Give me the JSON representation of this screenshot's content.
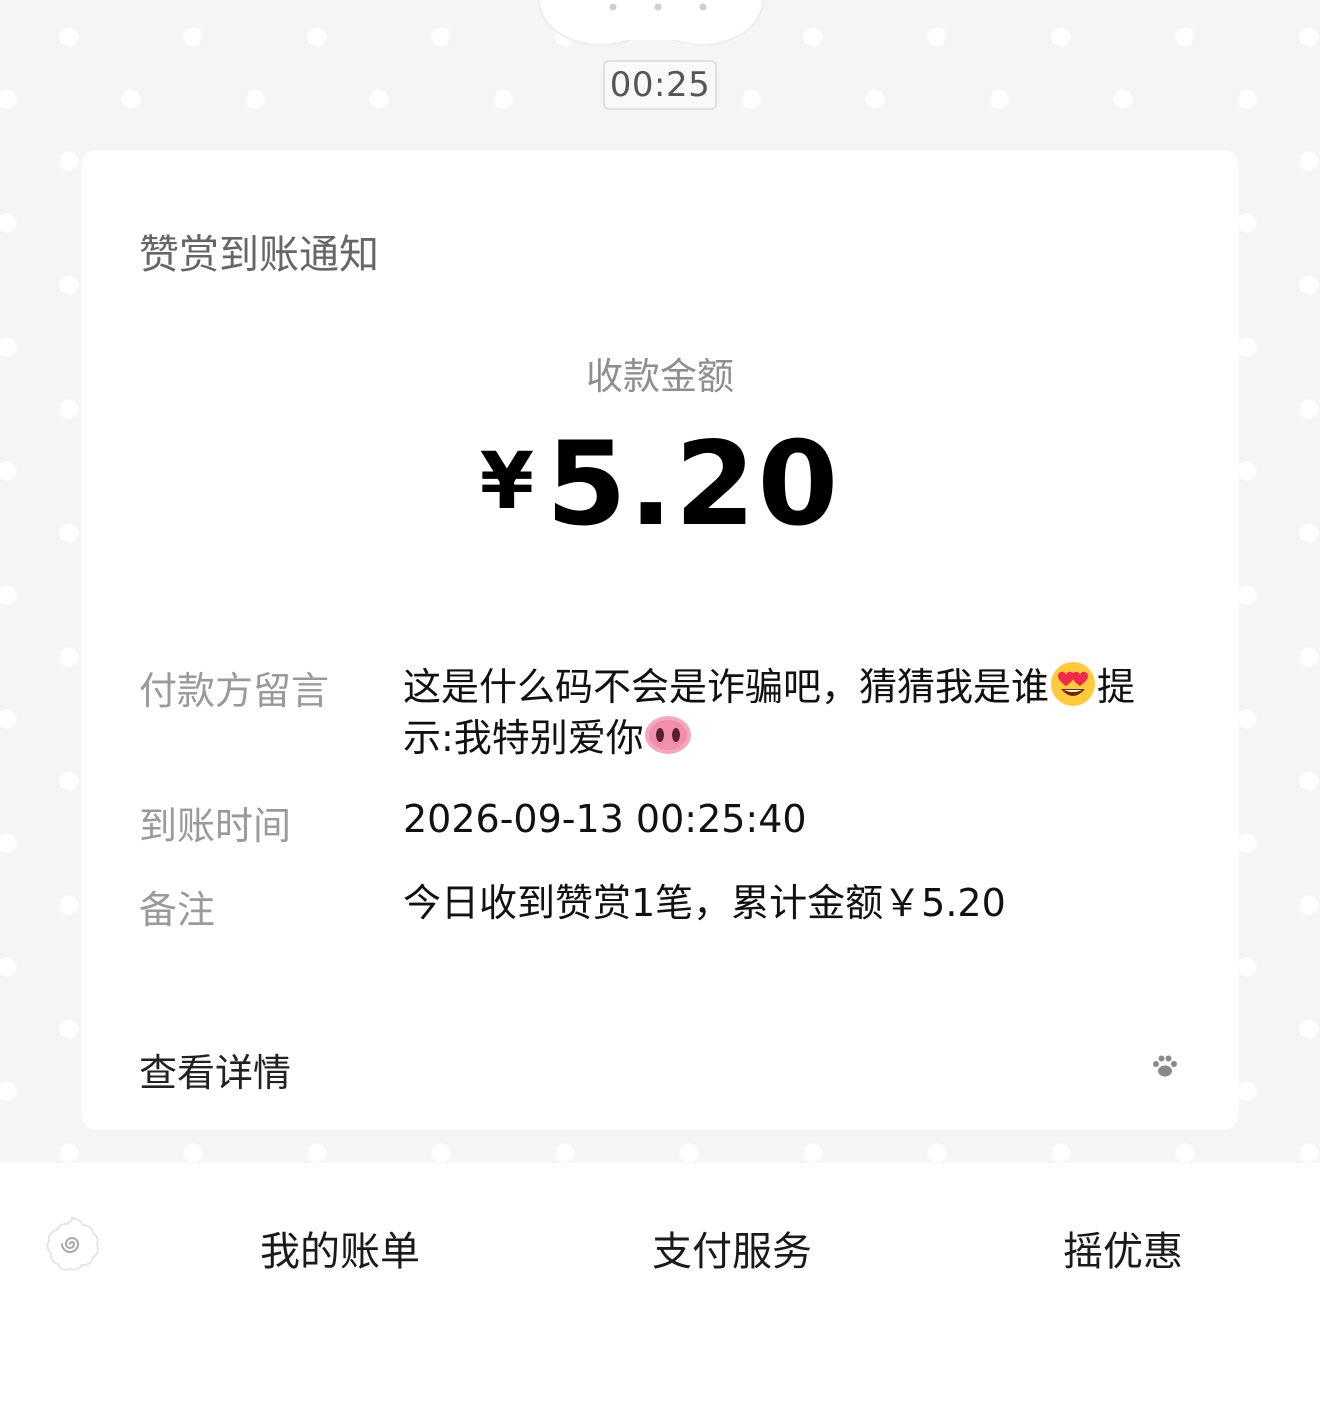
{
  "chat": {
    "timestamp": "00:25"
  },
  "card": {
    "title": "赞赏到账通知",
    "amount_label": "收款金额",
    "currency_symbol": "¥",
    "amount_value": "5.20",
    "rows": [
      {
        "label": "付款方留言",
        "value_part1": "这是什么码不会是诈骗吧，猜猜我是谁",
        "emoji1": "smiling-face-with-heart-eyes",
        "value_part2": "提示:我特别爱你",
        "emoji2": "pig-nose"
      },
      {
        "label": "到账时间",
        "value": "2026-09-13 00:25:40"
      },
      {
        "label": "备注",
        "value": "今日收到赞赏1笔，累计金额￥5.20"
      }
    ],
    "detail_label": "查看详情",
    "detail_icon": "paw-icon"
  },
  "bottom_menu": {
    "toggle_icon": "spiral-menu-icon",
    "items": [
      "我的账单",
      "支付服务",
      "摇优惠"
    ]
  }
}
